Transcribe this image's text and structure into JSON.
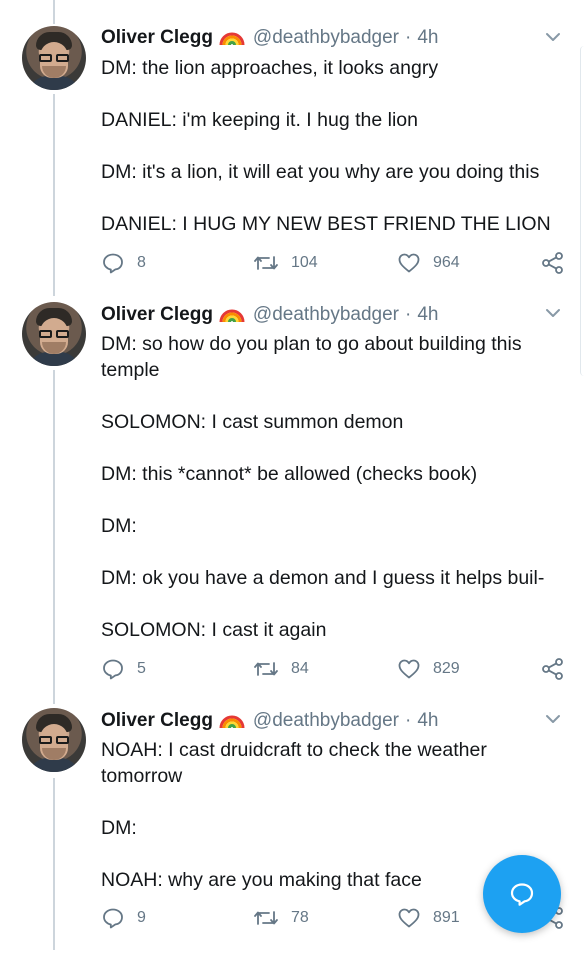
{
  "tweets": [
    {
      "author": "Oliver Clegg",
      "handle": "@deathbybadger",
      "separator": "·",
      "time": "4h",
      "lines": [
        "DM: the lion approaches, it looks angry",
        "",
        "DANIEL: i'm keeping it. I hug the lion",
        "",
        "DM: it's a lion, it will eat you why are you doing this",
        "",
        "DANIEL: I HUG MY NEW BEST FRIEND THE LION"
      ],
      "replies": "8",
      "retweets": "104",
      "likes": "964"
    },
    {
      "author": "Oliver Clegg",
      "handle": "@deathbybadger",
      "separator": "·",
      "time": "4h",
      "lines": [
        "DM: so how do you plan to go about building this",
        "temple",
        "",
        "SOLOMON: I cast summon demon",
        "",
        "DM: this *cannot* be allowed (checks book)",
        "",
        "DM:",
        "",
        "DM: ok you have a demon and I guess it helps buil-",
        "",
        "SOLOMON: I cast it again"
      ],
      "replies": "5",
      "retweets": "84",
      "likes": "829"
    },
    {
      "author": "Oliver Clegg",
      "handle": "@deathbybadger",
      "separator": "·",
      "time": "4h",
      "lines": [
        "NOAH: I cast druidcraft to check the weather",
        "tomorrow",
        "",
        "DM:",
        "",
        "NOAH: why are you making that face"
      ],
      "replies": "9",
      "retweets": "78",
      "likes": "891"
    }
  ],
  "colors": {
    "text": "#14171a",
    "secondary": "#657786",
    "thread_line": "#cdd5dc",
    "accent": "#1da1f2"
  },
  "icons": {
    "reply": "reply-icon",
    "retweet": "retweet-icon",
    "like": "heart-icon",
    "share": "share-icon",
    "caret": "chevron-down-icon",
    "compose": "compose-message-icon",
    "pride": "rainbow-emoji-icon"
  }
}
